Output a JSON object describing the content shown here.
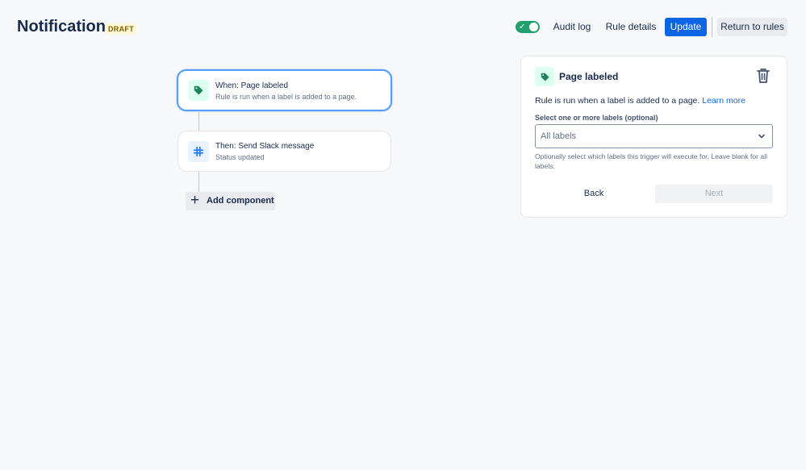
{
  "header": {
    "title": "Notification",
    "status_badge": "DRAFT",
    "audit_log": "Audit log",
    "rule_details": "Rule details",
    "update": "Update",
    "return_to_rules": "Return to rules"
  },
  "flow": {
    "trigger": {
      "title": "When: Page labeled",
      "subtitle": "Rule is run when a label is added to a page."
    },
    "action": {
      "title": "Then: Send Slack message",
      "subtitle": "Status updated"
    },
    "add_component": "Add component"
  },
  "panel": {
    "title": "Page labeled",
    "description": "Rule is run when a label is added to a page.",
    "learn_more": "Learn more",
    "field_label": "Select one or more labels (optional)",
    "select_value": "All labels",
    "help_text": "Optionally select which labels this trigger will execute for. Leave blank for all labels.",
    "back": "Back",
    "next": "Next"
  },
  "colors": {
    "primary": "#0c66e4",
    "toggle_on": "#22a06b",
    "selected_border": "#579dff"
  },
  "icons": [
    "checkmark-icon",
    "tag-icon",
    "slack-icon",
    "plus-icon",
    "trash-icon",
    "chevron-down-icon"
  ]
}
